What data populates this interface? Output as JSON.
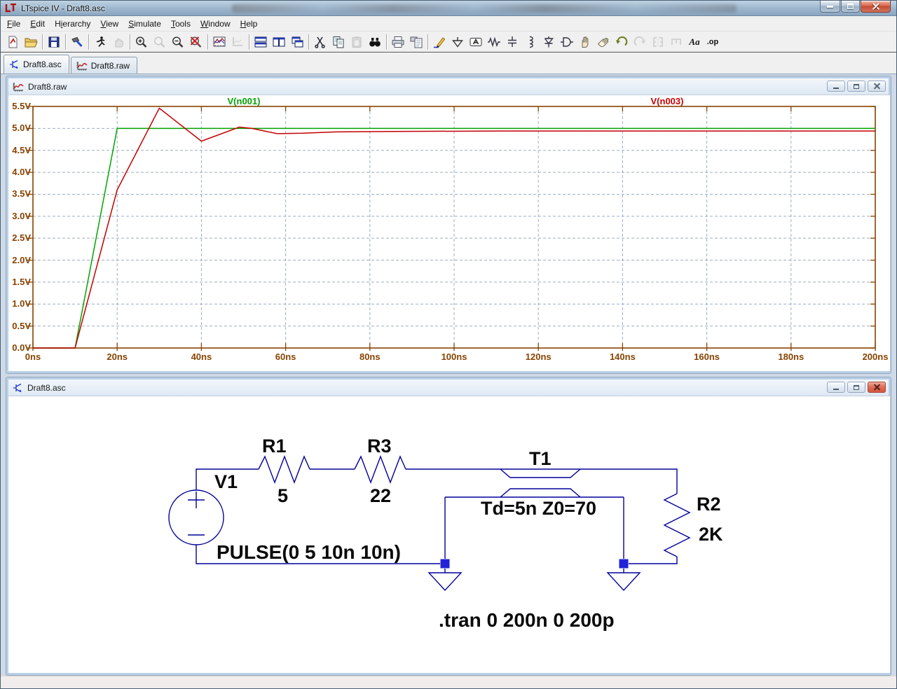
{
  "app": {
    "title": "LTspice IV - Draft8.asc"
  },
  "menu": {
    "items": [
      {
        "label": "File",
        "accel": 0
      },
      {
        "label": "Edit",
        "accel": 0
      },
      {
        "label": "Hierarchy",
        "accel": 1
      },
      {
        "label": "View",
        "accel": 0
      },
      {
        "label": "Simulate",
        "accel": 0
      },
      {
        "label": "Tools",
        "accel": 0
      },
      {
        "label": "Window",
        "accel": 0
      },
      {
        "label": "Help",
        "accel": 0
      }
    ]
  },
  "toolbar": {
    "aa_label": "Aa",
    "op_label": ".op"
  },
  "tabs": [
    {
      "label": "Draft8.asc"
    },
    {
      "label": "Draft8.raw"
    }
  ],
  "waveform_window": {
    "title": "Draft8.raw"
  },
  "schematic_window": {
    "title": "Draft8.asc",
    "components": [
      {
        "ref": "V1",
        "value": "PULSE(0 5 10n 10n)"
      },
      {
        "ref": "R1",
        "value": "5"
      },
      {
        "ref": "R3",
        "value": "22"
      },
      {
        "ref": "T1",
        "value": "Td=5n Z0=70"
      },
      {
        "ref": "R2",
        "value": "2K"
      }
    ],
    "directive": ".tran 0 200n 0 200p"
  },
  "chart_data": {
    "type": "line",
    "title": "",
    "xlabel": "",
    "ylabel": "",
    "xlim": [
      0,
      200
    ],
    "ylim": [
      0,
      5.5
    ],
    "x_unit": "ns",
    "y_unit": "V",
    "grid": true,
    "legend_position": "top",
    "x_tick_values": [
      0,
      20,
      40,
      60,
      80,
      100,
      120,
      140,
      160,
      180,
      200
    ],
    "x_ticks": [
      "0ns",
      "20ns",
      "40ns",
      "60ns",
      "80ns",
      "100ns",
      "120ns",
      "140ns",
      "160ns",
      "180ns",
      "200ns"
    ],
    "y_tick_values": [
      5.5,
      5.0,
      4.5,
      4.0,
      3.5,
      3.0,
      2.5,
      2.0,
      1.5,
      1.0,
      0.5,
      0.0
    ],
    "y_ticks": [
      "5.5V",
      "5.0V",
      "4.5V",
      "4.0V",
      "3.5V",
      "3.0V",
      "2.5V",
      "2.0V",
      "1.5V",
      "1.0V",
      "0.5V",
      "0.0V"
    ],
    "x_grid_step": 20,
    "y_grid_step": 0.5,
    "axis_color": "#874300",
    "grid_color": "#9AAEC2",
    "series": [
      {
        "name": "V(n001)",
        "color": "#00A400",
        "points": [
          [
            0,
            0
          ],
          [
            10,
            0
          ],
          [
            20,
            5.0
          ],
          [
            200,
            5.0
          ]
        ]
      },
      {
        "name": "V(n003)",
        "color": "#C40000",
        "points": [
          [
            0,
            0
          ],
          [
            10,
            0
          ],
          [
            20,
            3.6
          ],
          [
            30,
            5.46
          ],
          [
            40,
            4.71
          ],
          [
            49,
            5.03
          ],
          [
            52,
            5.0
          ],
          [
            58,
            4.88
          ],
          [
            64,
            4.89
          ],
          [
            72,
            4.92
          ],
          [
            85,
            4.93
          ],
          [
            110,
            4.94
          ],
          [
            200,
            4.94
          ]
        ]
      }
    ]
  }
}
